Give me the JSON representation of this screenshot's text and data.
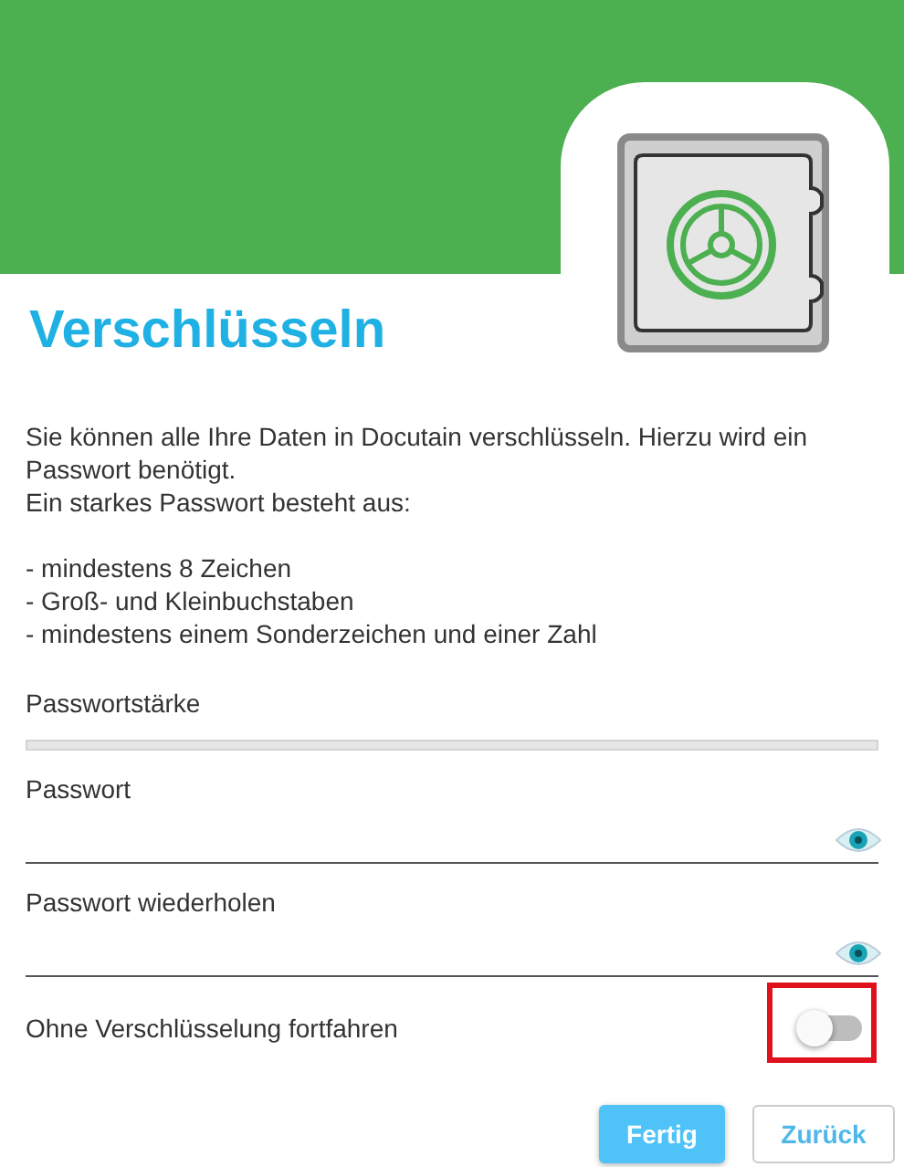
{
  "title": "Verschlüsseln",
  "intro": "Sie können alle Ihre Daten in Docutain verschlüsseln. Hierzu wird ein Passwort benötigt.\nEin starkes Passwort besteht aus:",
  "requirements": [
    "- mindestens 8 Zeichen",
    "- Groß- und Kleinbuchstaben",
    "- mindestens einem Sonderzeichen und einer Zahl"
  ],
  "strength": {
    "label": "Passwortstärke",
    "level": 0
  },
  "fields": [
    {
      "label": "Passwort"
    },
    {
      "label": "Passwort wiederholen"
    }
  ],
  "toggle": {
    "label": "Ohne Verschlüsselung fortfahren",
    "on": false,
    "highlighted": true
  },
  "buttons": [
    {
      "label": "Fertig",
      "kind": "primary"
    },
    {
      "label": "Zurück",
      "kind": "secondary"
    }
  ]
}
